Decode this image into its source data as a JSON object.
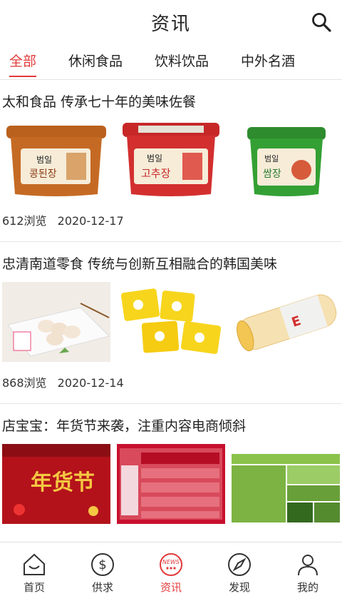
{
  "header": {
    "title": "资讯"
  },
  "tabs": [
    {
      "label": "全部"
    },
    {
      "label": "休闲食品"
    },
    {
      "label": "饮料饮品"
    },
    {
      "label": "中外名酒"
    }
  ],
  "articles": [
    {
      "title": "太和食品 传承七十年的美味佐餐",
      "views": "612浏览",
      "date": "2020-12-17",
      "thumb_labels": [
        "콩된장",
        "고추장",
        "쌈장"
      ],
      "brand_mark": "범일"
    },
    {
      "title": "忠清南道零食 传统与创新互相融合的韩国美味",
      "views": "868浏览",
      "date": "2020-12-14"
    },
    {
      "title": "店宝宝：年货节来袭，注重内容电商倾斜",
      "poster_text": "年货节"
    }
  ],
  "nav": [
    {
      "label": "首页",
      "icon": "home-icon"
    },
    {
      "label": "供求",
      "icon": "dollar-icon"
    },
    {
      "label": "资讯",
      "icon": "news-icon"
    },
    {
      "label": "发现",
      "icon": "compass-icon"
    },
    {
      "label": "我的",
      "icon": "user-icon"
    }
  ],
  "colors": {
    "accent": "#e23a3a"
  }
}
